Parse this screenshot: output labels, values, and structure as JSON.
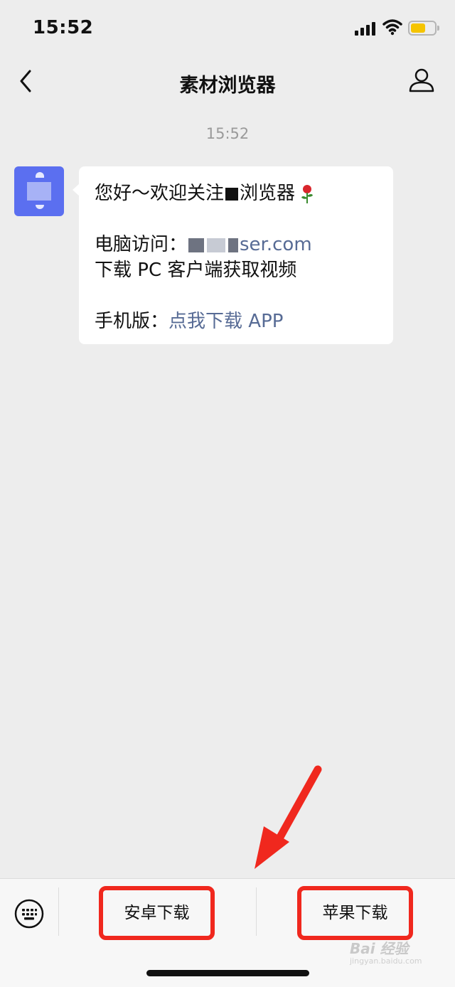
{
  "status_bar": {
    "time": "15:52"
  },
  "header": {
    "title": "素材浏览器"
  },
  "chat": {
    "timestamp": "15:52",
    "message": {
      "line1": "您好～欢迎关注",
      "line1_suffix": "浏览器",
      "line2_prefix": "电脑访问：",
      "line2_link": "ser.com",
      "line3": "下载 PC 客户端获取视频",
      "line4_prefix": "手机版：",
      "line4_link": "点我下载 APP"
    }
  },
  "menu": {
    "items": [
      {
        "label": "安卓下载"
      },
      {
        "label": "苹果下载"
      }
    ]
  },
  "colors": {
    "link": "#576b95",
    "highlight_box": "#f0281e",
    "avatar": "#5b6ff0"
  },
  "watermark": {
    "brand": "Bai 经验",
    "url": "jingyan.baidu.com"
  }
}
